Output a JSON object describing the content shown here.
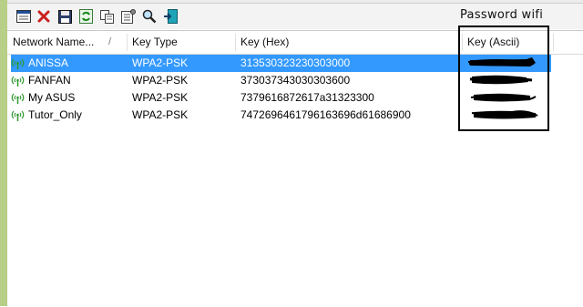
{
  "annotation": {
    "label": "Password wifi"
  },
  "toolbar": {
    "buttons": [
      {
        "name": "html-report-icon"
      },
      {
        "name": "delete-icon",
        "color": "#cc1f1f"
      },
      {
        "name": "save-icon"
      },
      {
        "name": "refresh-icon"
      },
      {
        "name": "copy-icon"
      },
      {
        "name": "properties-icon"
      },
      {
        "name": "find-icon"
      },
      {
        "name": "exit-icon"
      }
    ]
  },
  "table": {
    "columns": [
      "Network Name...",
      "Key Type",
      "Key (Hex)",
      "Key (Ascii)"
    ],
    "sort_indicator": "/",
    "rows": [
      {
        "name": "ANISSA",
        "key_type": "WPA2-PSK",
        "key_hex": "313530323230303000",
        "selected": true
      },
      {
        "name": "FANFAN",
        "key_type": "WPA2-PSK",
        "key_hex": "373037343030303600"
      },
      {
        "name": "My ASUS",
        "key_type": "WPA2-PSK",
        "key_hex": "7379616872617a31323300"
      },
      {
        "name": "Tutor_Only",
        "key_type": "WPA2-PSK",
        "key_hex": "7472696461796163696d61686900"
      }
    ]
  },
  "colors": {
    "selection": "#3399ff",
    "wifi_icon": "#2e9a2e",
    "frame": "#b7cf86"
  }
}
